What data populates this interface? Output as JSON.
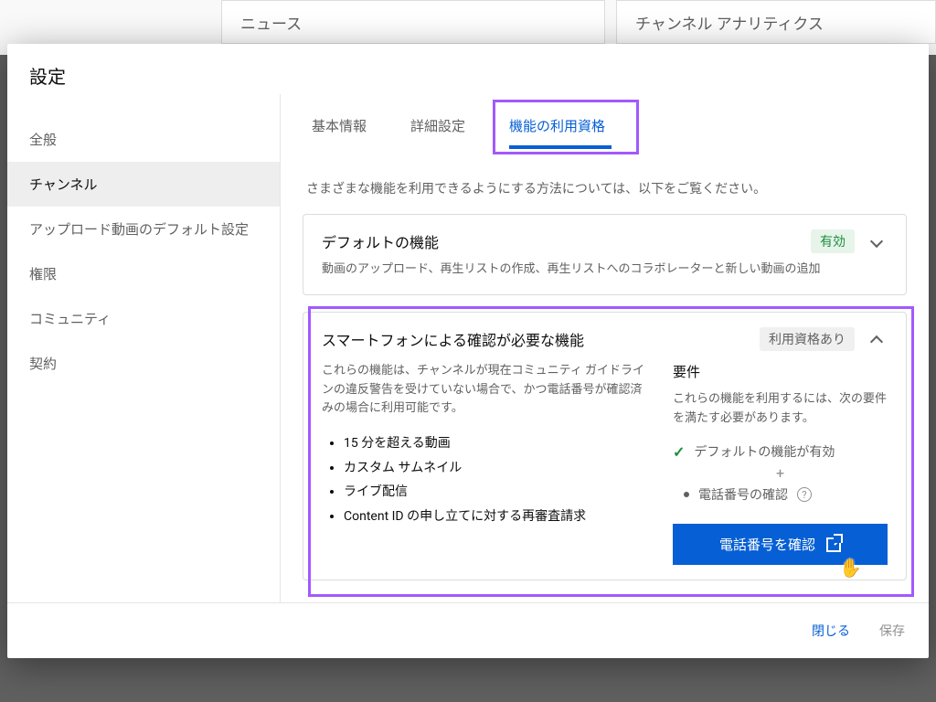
{
  "bg": {
    "left_label": "ニュース",
    "right_label": "チャンネル アナリティクス"
  },
  "modal": {
    "title": "設定"
  },
  "sidebar": {
    "items": [
      {
        "label": "全般"
      },
      {
        "label": "チャンネル"
      },
      {
        "label": "アップロード動画のデフォルト設定"
      },
      {
        "label": "権限"
      },
      {
        "label": "コミュニティ"
      },
      {
        "label": "契約"
      }
    ]
  },
  "tabs": {
    "t0": "基本情報",
    "t1": "詳細設定",
    "t2": "機能の利用資格"
  },
  "intro": "さまざまな機能を利用できるようにする方法については、以下をご覧ください。",
  "card_default": {
    "title": "デフォルトの機能",
    "status": "有効",
    "subtitle": "動画のアップロード、再生リストの作成、再生リストへのコラボレーターと新しい動画の追加"
  },
  "card_phone": {
    "title": "スマートフォンによる確認が必要な機能",
    "status": "利用資格あり",
    "desc": "これらの機能は、チャンネルが現在コミュニティ ガイドラインの違反警告を受けていない場合で、かつ電話番号が確認済みの場合に利用可能です。",
    "bullets": [
      "15 分を超える動画",
      "カスタム サムネイル",
      "ライブ配信",
      "Content ID の申し立てに対する再審査請求"
    ],
    "req_title": "要件",
    "req_desc": "これらの機能を利用するには、次の要件を満たす必要があります。",
    "req1": "デフォルトの機能が有効",
    "req2": "電話番号の確認",
    "verify_btn": "電話番号を確認"
  },
  "footer": {
    "close": "閉じる",
    "save": "保存"
  }
}
